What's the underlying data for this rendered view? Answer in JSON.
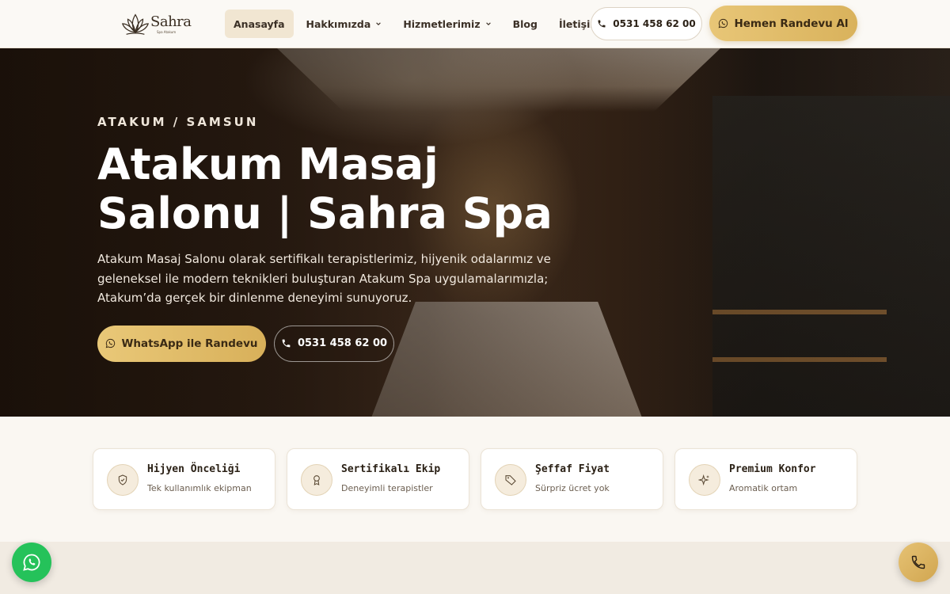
{
  "brand": {
    "name": "Sahra",
    "subtitle": "Spa Atakum",
    "logo_icon": "lotus-icon"
  },
  "nav": {
    "items": [
      {
        "label": "Anasayfa",
        "active": true,
        "has_dropdown": false
      },
      {
        "label": "Hakkımızda",
        "active": false,
        "has_dropdown": true
      },
      {
        "label": "Hizmetlerimiz",
        "active": false,
        "has_dropdown": true
      },
      {
        "label": "Blog",
        "active": false,
        "has_dropdown": false
      },
      {
        "label": "İletişim",
        "active": false,
        "has_dropdown": false
      }
    ],
    "phone": "0531 458 62 00",
    "cta": "Hemen Randevu Al"
  },
  "hero": {
    "eyebrow": "ATAKUM / SAMSUN",
    "title": "Atakum Masaj Salonu | Sahra Spa",
    "description": "Atakum Masaj Salonu olarak sertifikalı terapistlerimiz, hijyenik odalarımız ve geleneksel ile modern teknikleri buluşturan Atakum Spa uygulamalarımızla; Atakum’da gerçek bir dinlenme deneyimi sunuyoruz.",
    "whatsapp_button": "WhatsApp ile Randevu",
    "call_button": "0531 458 62 00"
  },
  "features": [
    {
      "title": "Hijyen Önceliği",
      "subtitle": "Tek kullanımlık ekipman",
      "icon": "shield-icon"
    },
    {
      "title": "Sertifikalı Ekip",
      "subtitle": "Deneyimli terapistler",
      "icon": "award-icon"
    },
    {
      "title": "Şeffaf Fiyat",
      "subtitle": "Sürpriz ücret yok",
      "icon": "tag-icon"
    },
    {
      "title": "Premium Konfor",
      "subtitle": "Aromatik ortam",
      "icon": "sparkles-icon"
    }
  ],
  "colors": {
    "accent_gold": "#d9b25c",
    "whatsapp_green": "#25c25a",
    "page_bg": "#faf7f2"
  }
}
